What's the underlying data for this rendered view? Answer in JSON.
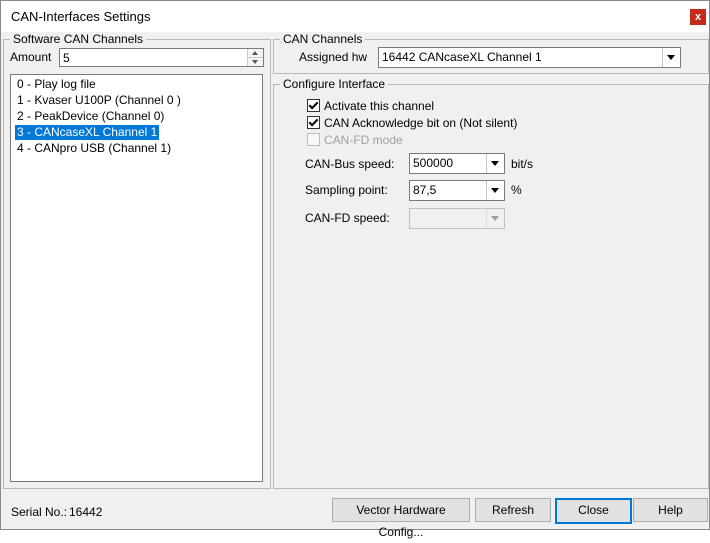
{
  "window": {
    "title": "CAN-Interfaces Settings",
    "close_glyph": "x"
  },
  "software_group": {
    "label": "Software CAN Channels",
    "amount_label": "Amount",
    "amount_value": "5",
    "items": [
      "0 - Play log file",
      "1 - Kvaser U100P (Channel 0 )",
      "2 - PeakDevice (Channel 0)",
      "3 - CANcaseXL Channel 1",
      "4 - CANpro USB (Channel 1)"
    ],
    "selected_index": 3
  },
  "channels_group": {
    "label": "CAN Channels",
    "assigned_label": "Assigned hw",
    "assigned_value": "16442 CANcaseXL Channel 1"
  },
  "configure_group": {
    "label": "Configure Interface",
    "activate_label": "Activate this channel",
    "activate_checked": true,
    "ack_label": "CAN Acknowledge bit on (Not silent)",
    "ack_checked": true,
    "canfd_mode_label": "CAN-FD mode",
    "canfd_mode_checked": false,
    "canfd_mode_enabled": false,
    "bus_speed_label": "CAN-Bus speed:",
    "bus_speed_value": "500000",
    "bus_speed_unit": "bit/s",
    "sampling_label": "Sampling point:",
    "sampling_value": "87,5",
    "sampling_unit": "%",
    "fd_speed_label": "CAN-FD speed:",
    "fd_speed_value": ""
  },
  "footer": {
    "serial_label": "Serial No.:",
    "serial_value": "16442",
    "vector_button": "Vector Hardware Config...",
    "refresh_button": "Refresh",
    "close_button": "Close",
    "help_button": "Help"
  },
  "colors": {
    "selection": "#0078d7",
    "close_button_bg": "#c42b1c",
    "window_bg": "#f0f0f0"
  }
}
